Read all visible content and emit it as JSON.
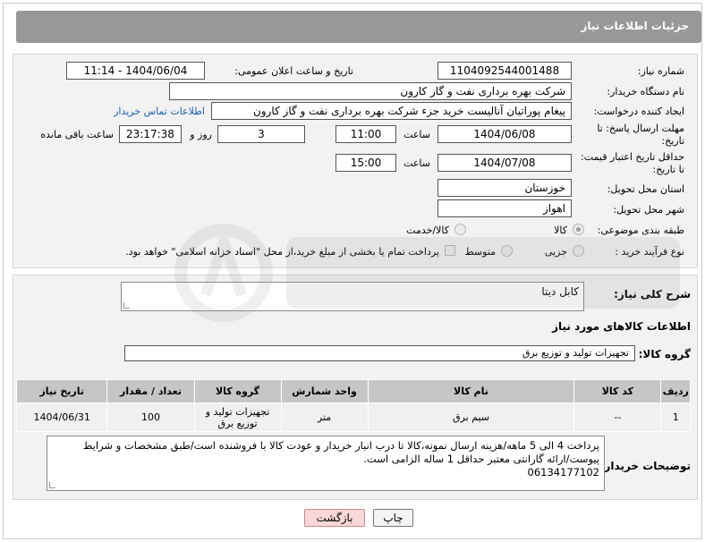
{
  "header": {
    "title": "جزئیات اطلاعات نیاز"
  },
  "form": {
    "need_number_label": "شماره نیاز:",
    "need_number": "1104092544001488",
    "announce_label": "تاریخ و ساعت اعلان عمومی:",
    "announce_value": "1404/06/04 - 11:14",
    "buyer_org_label": "نام دستگاه خریدار:",
    "buyer_org": "شرکت بهره برداری نفت و گاز کارون",
    "creator_label": "ایجاد کننده درخواست:",
    "creator": "پیغام پوراتیان آنالیست خرید جزء شرکت بهره برداری نفت و گاز کارون",
    "contact_link": "اطلاعات تماس خریدار",
    "reply_deadline_label_1": "مهلت ارسال پاسخ: تا",
    "reply_deadline_label_2": "تاریخ:",
    "reply_date": "1404/06/08",
    "time_label": "ساعت",
    "reply_time": "11:00",
    "days_value": "3",
    "days_label": "روز و",
    "remaining_time": "23:17:38",
    "remaining_label": "ساعت باقی مانده",
    "price_validity_label_1": "حداقل تاریخ اعتبار قیمت:",
    "price_validity_label_2": "تا تاریخ:",
    "price_date": "1404/07/08",
    "price_time": "15:00",
    "province_label": "استان محل تحویل:",
    "province": "خوزستان",
    "city_label": "شهر محل تحویل:",
    "city": "اهواز",
    "category_label": "طبقه بندی موضوعی:",
    "category_options": [
      "کالا",
      "کالا/خدمت"
    ],
    "process_label": "نوع فرآیند خرید :",
    "process_options": [
      "جزیی",
      "متوسط"
    ],
    "payment_note": "پرداخت تمام یا بخشی از مبلغ خرید،از محل \"اسناد خزانه اسلامی\" خواهد بود."
  },
  "description": {
    "label": "شرح کلی نیاز:",
    "value": "کابل دیتا"
  },
  "goods": {
    "section_title": "اطلاعات کالاهای مورد نیاز",
    "group_label": "گروه کالا:",
    "group_value": "تجهیزات تولید و توزیع برق",
    "columns": [
      "ردیف",
      "کد کالا",
      "نام کالا",
      "واحد شمارش",
      "گروه کالا",
      "تعداد / مقدار",
      "تاریخ نیاز"
    ],
    "rows": [
      [
        "1",
        "--",
        "سیم برق",
        "متر",
        "تجهیزات تولید و توزیع برق",
        "100",
        "1404/06/31"
      ]
    ]
  },
  "buyer_notes": {
    "label": "توضیحات خریدار:",
    "line1": "پرداخت 4 الی 5 ماهه/هزینه ارسال نمونه،کالا تا درب انبار خریدار و عودت کالا با فروشنده است/طبق مشخصات و شرایط",
    "line2": "پیوست/ارائه گارانتی معتبر حداقل 1 ساله الزامی است.",
    "line3": "06134177102"
  },
  "buttons": {
    "print": "چاپ",
    "back": "بازگشت"
  },
  "colors": {
    "header_bg": "#989898",
    "panel_bg": "#f2f2f2",
    "link": "#1a5fb4",
    "back_button_bg": "#f8d7d7"
  }
}
